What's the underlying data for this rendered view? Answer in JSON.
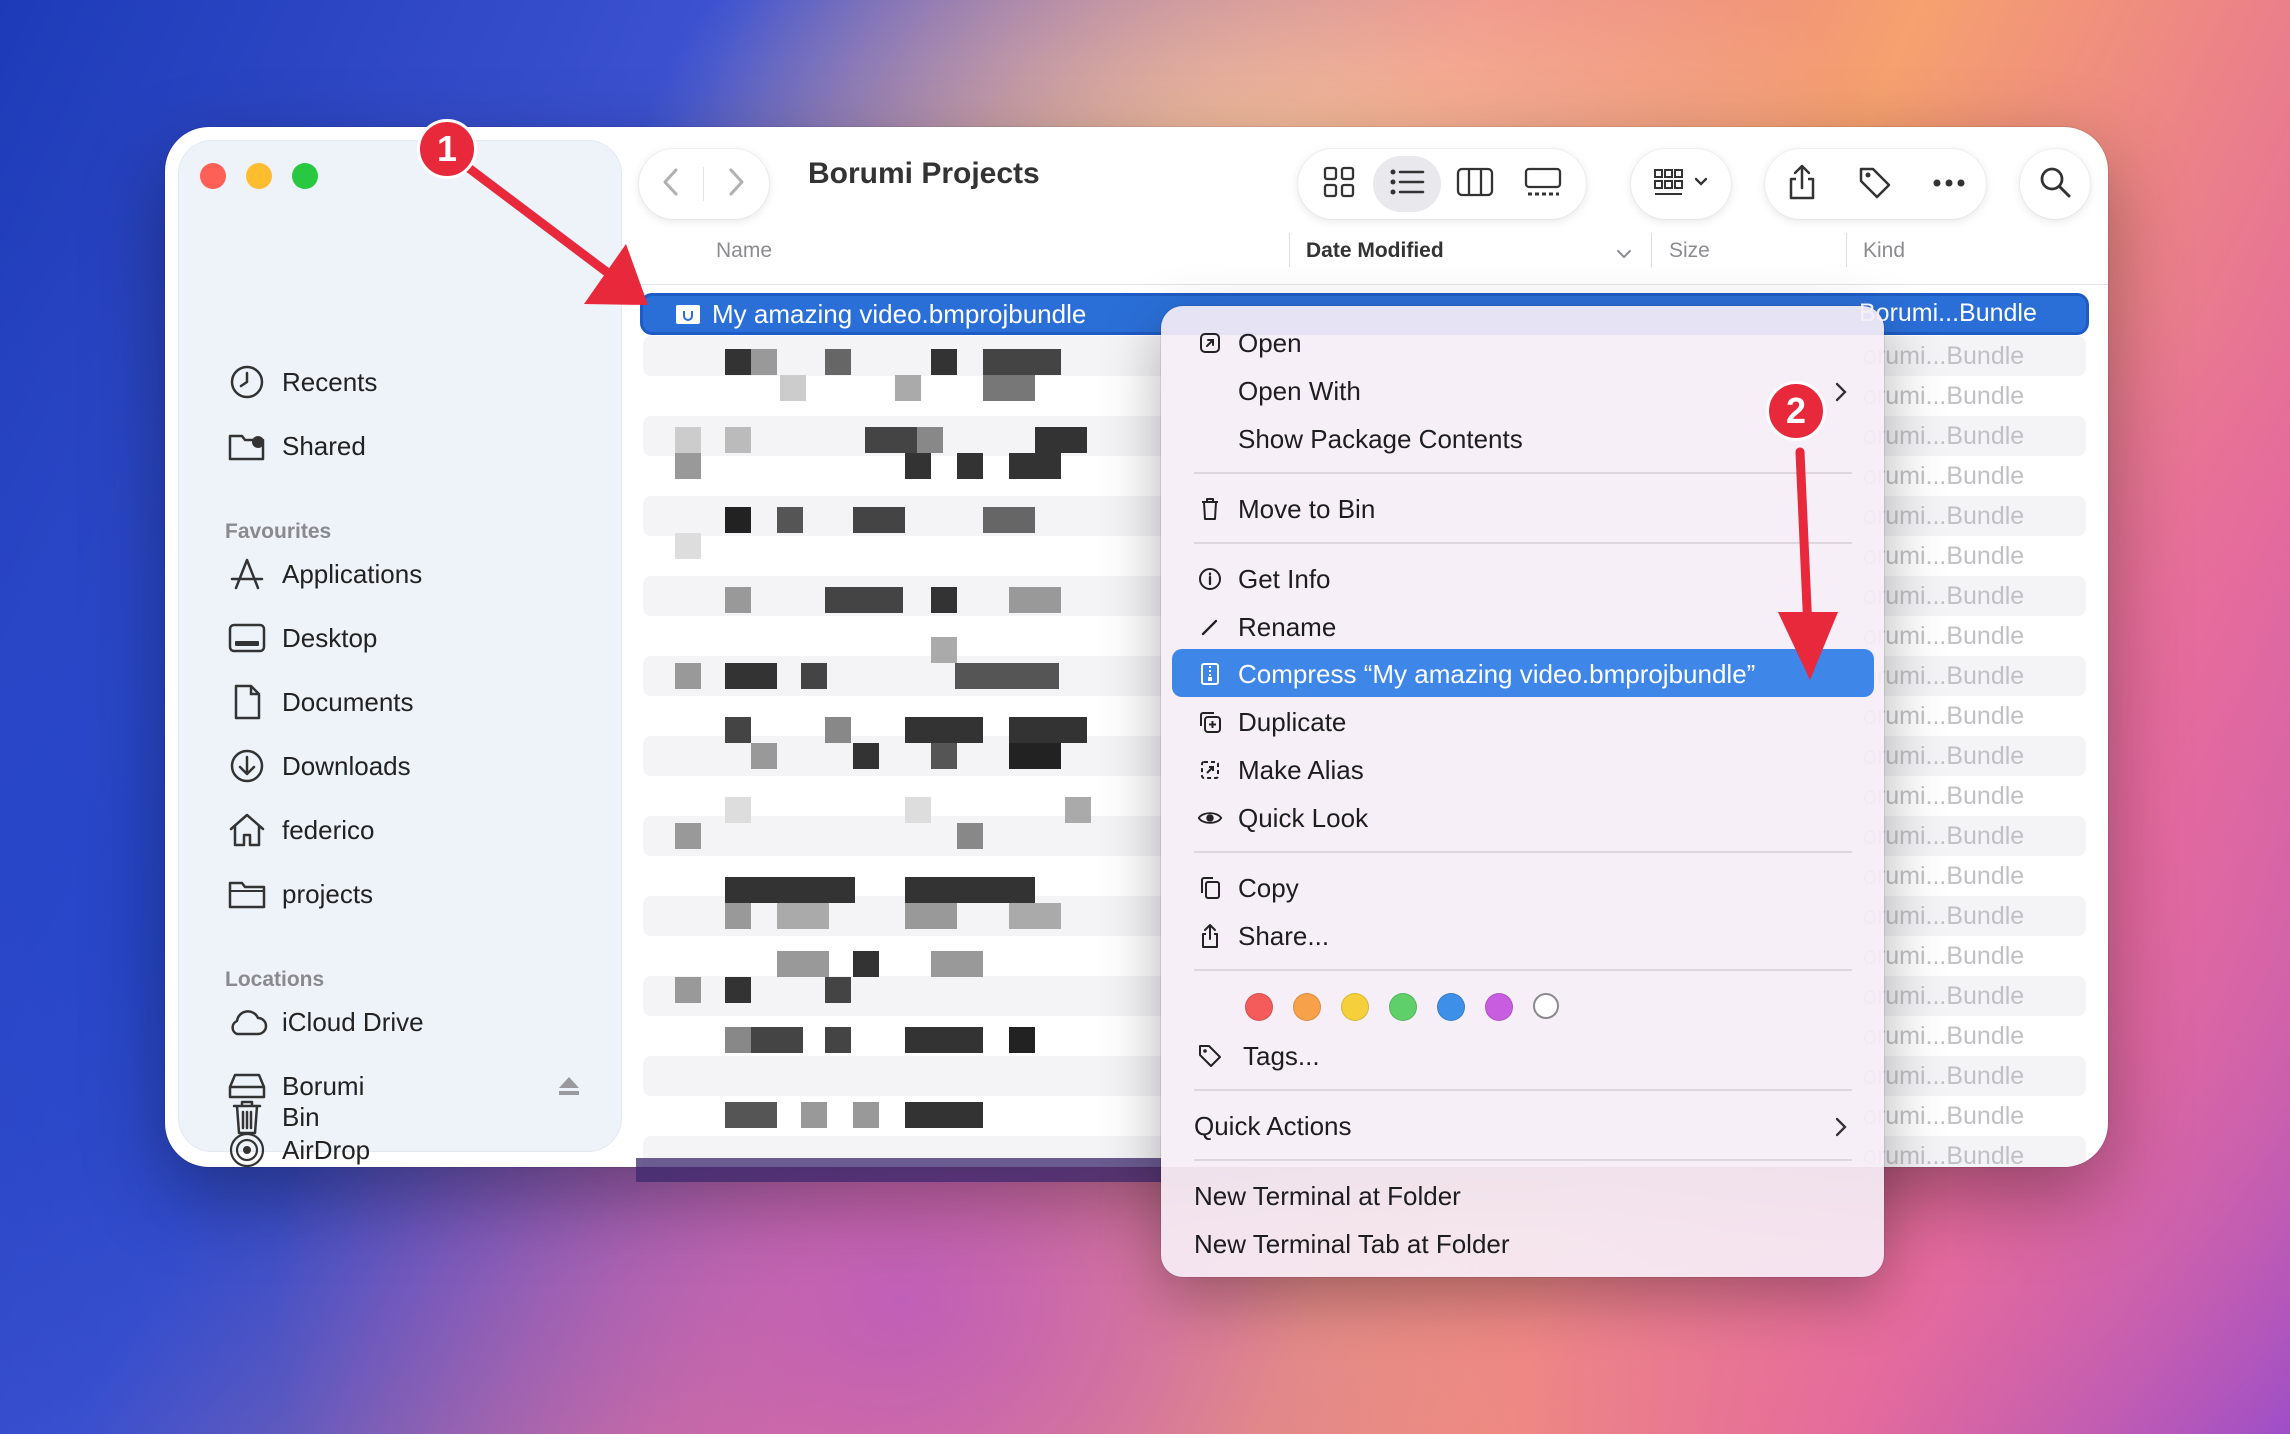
{
  "window": {
    "title": "Borumi Projects"
  },
  "sidebar": {
    "top_items": [
      {
        "label": "Recents",
        "icon": "clock-icon"
      },
      {
        "label": "Shared",
        "icon": "shared-folder-icon"
      }
    ],
    "favourites_heading": "Favourites",
    "favourites": [
      {
        "label": "Applications",
        "icon": "applications-icon"
      },
      {
        "label": "Desktop",
        "icon": "desktop-icon"
      },
      {
        "label": "Documents",
        "icon": "document-icon"
      },
      {
        "label": "Downloads",
        "icon": "download-icon"
      },
      {
        "label": "federico",
        "icon": "home-icon"
      },
      {
        "label": "projects",
        "icon": "folder-icon"
      }
    ],
    "locations_heading": "Locations",
    "locations": [
      {
        "label": "iCloud Drive",
        "icon": "cloud-icon"
      },
      {
        "label": "Borumi",
        "icon": "drive-icon"
      },
      {
        "label": "AirDrop",
        "icon": "airdrop-icon"
      },
      {
        "label": "Bin",
        "icon": "trash-icon"
      }
    ]
  },
  "columns": {
    "name": "Name",
    "date_modified": "Date Modified",
    "size": "Size",
    "kind": "Kind"
  },
  "selected_file": {
    "name": "My amazing video.bmprojbundle",
    "kind": "Borumi...Bundle"
  },
  "rows_kind": "orumi...Bundle",
  "context_menu": {
    "open": "Open",
    "open_with": "Open With",
    "show_package_contents": "Show Package Contents",
    "move_to_bin": "Move to Bin",
    "get_info": "Get Info",
    "rename": "Rename",
    "compress": "Compress “My amazing video.bmprojbundle”",
    "duplicate": "Duplicate",
    "make_alias": "Make Alias",
    "quick_look": "Quick Look",
    "copy": "Copy",
    "share": "Share...",
    "tags": "Tags...",
    "quick_actions": "Quick Actions",
    "new_terminal": "New Terminal at Folder",
    "new_terminal_tab": "New Terminal Tab at Folder",
    "tag_colors": [
      "#f45b5b",
      "#f7a14a",
      "#f5d03c",
      "#5fcf6a",
      "#3d8fe8",
      "#c95de0",
      "#ffffff"
    ]
  },
  "annotations": {
    "step1": "1",
    "step2": "2",
    "color": "#e8283b"
  }
}
